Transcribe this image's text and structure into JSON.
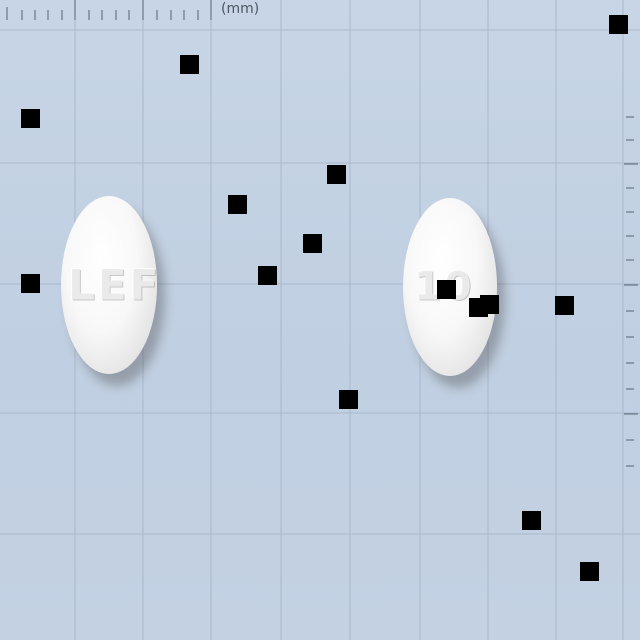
{
  "ruler": {
    "unit_label": "(mm)"
  },
  "pills": [
    {
      "imprint": "LEF",
      "color": "#ffffff"
    },
    {
      "imprint": "10",
      "color": "#ffffff"
    }
  ],
  "colors": {
    "background": "#c4d2e3",
    "grid": "#a7b6c8",
    "marker": "#000000"
  },
  "marker_count": 16
}
